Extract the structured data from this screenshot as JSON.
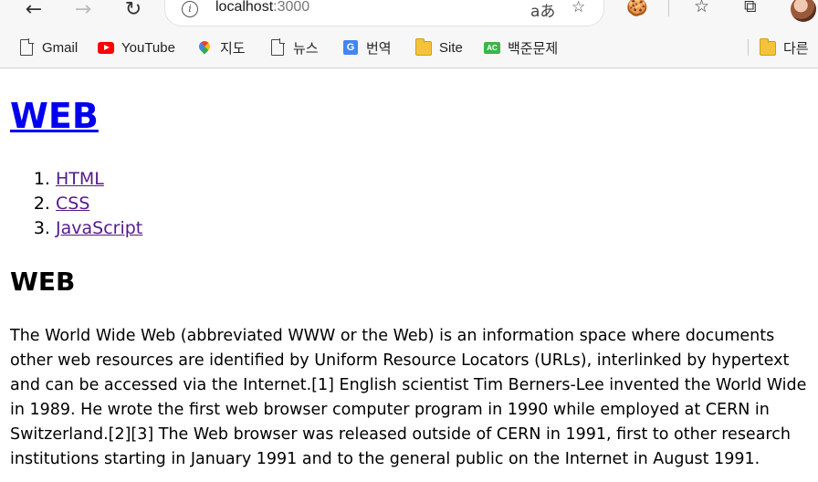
{
  "browser": {
    "url_host": "localhost",
    "url_port": ":3000",
    "bookmarks": [
      {
        "label": "Gmail",
        "icon": "file-icon"
      },
      {
        "label": "YouTube",
        "icon": "youtube-icon"
      },
      {
        "label": "지도",
        "icon": "maps-icon"
      },
      {
        "label": "뉴스",
        "icon": "file-icon"
      },
      {
        "label": "번역",
        "icon": "translate-icon"
      },
      {
        "label": "Site",
        "icon": "folder-icon"
      },
      {
        "label": "백준문제",
        "icon": "ac-icon"
      },
      {
        "label": "다른",
        "icon": "folder-icon"
      }
    ],
    "translate_badge": "AC"
  },
  "page": {
    "title": "WEB",
    "nav": [
      {
        "label": "HTML"
      },
      {
        "label": "CSS"
      },
      {
        "label": "JavaScript"
      }
    ],
    "heading": "WEB",
    "description_lines": [
      "The World Wide Web (abbreviated WWW or the Web) is an information space where documents",
      "other web resources are identified by Uniform Resource Locators (URLs), interlinked by hypertext",
      "and can be accessed via the Internet.[1] English scientist Tim Berners-Lee invented the World Wide",
      "in 1989. He wrote the first web browser computer program in 1990 while employed at CERN in",
      "Switzerland.[2][3] The Web browser was released outside of CERN in 1991, first to other research",
      "institutions starting in January 1991 and to the general public on the Internet in August 1991."
    ]
  }
}
